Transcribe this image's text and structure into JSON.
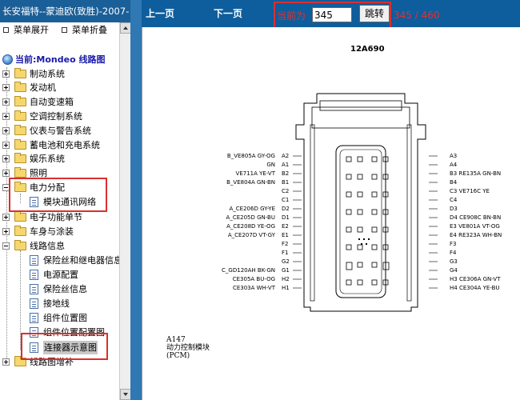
{
  "app": {
    "title": "长安福特--蒙迪欧(致胜)-2007-"
  },
  "left_menu": {
    "expand_label": "菜单展开",
    "collapse_label": "菜单折叠"
  },
  "tree": {
    "root_label": "当前:Mondeo 线路图",
    "items": [
      {
        "label": "制动系统"
      },
      {
        "label": "发动机"
      },
      {
        "label": "自动变速箱"
      },
      {
        "label": "空调控制系统"
      },
      {
        "label": "仪表与警告系统"
      },
      {
        "label": "蓄电池和充电系统"
      },
      {
        "label": "娱乐系统"
      },
      {
        "label": "照明"
      },
      {
        "label": "电力分配"
      },
      {
        "label": "模块通讯网络"
      },
      {
        "label": "电子功能单节"
      },
      {
        "label": "车身与涂装"
      },
      {
        "label": "线路信息"
      },
      {
        "label": "保险丝和继电器信息"
      },
      {
        "label": "电源配置"
      },
      {
        "label": "保险丝信息"
      },
      {
        "label": "接地线"
      },
      {
        "label": "组件位置图"
      },
      {
        "label": "组件位置配置图"
      },
      {
        "label": "连接器示意图"
      },
      {
        "label": "线路图增补"
      }
    ]
  },
  "toolbar": {
    "prev_label": "上一页",
    "next_label": "下一页",
    "current_label": "当前为",
    "page_value": "345",
    "jump_label": "跳转",
    "page_count": "345 / 460"
  },
  "connector": {
    "id": "12A690",
    "left_labels": [
      "B_VE805A GY-OG",
      "A2",
      "GN",
      "A1",
      "VE711A YE-VT",
      "B2",
      "B_VE804A GN-BN",
      "B1",
      "C2",
      "C1",
      "A_CE206D GY-YE",
      "D2",
      "A_CE205D GN-BU",
      "D1",
      "A_CE208D YE-OG",
      "E2",
      "A_CE207D VT-GY",
      "E1",
      "F2",
      "F1",
      "G2",
      "C_GD120AH BK-GN",
      "G1",
      "CE305A BU-OG",
      "H2",
      "CE303A WH-VT",
      "H1"
    ],
    "right_labels": [
      "A3",
      "A4",
      "B3 RE135A GN-BN",
      "B4",
      "C3 VE716C YE",
      "C4",
      "D3",
      "D4 CE908C BN-BN",
      "E3 VE801A VT-OG",
      "E4 RE323A WH-BN",
      "F3",
      "F4",
      "G3",
      "G4",
      "H3 CE306A GN-VT",
      "H4 CE304A YE-BU"
    ],
    "caption_code": "A147",
    "caption_name": "动力控制模块",
    "caption_abbr": "(PCM)"
  }
}
